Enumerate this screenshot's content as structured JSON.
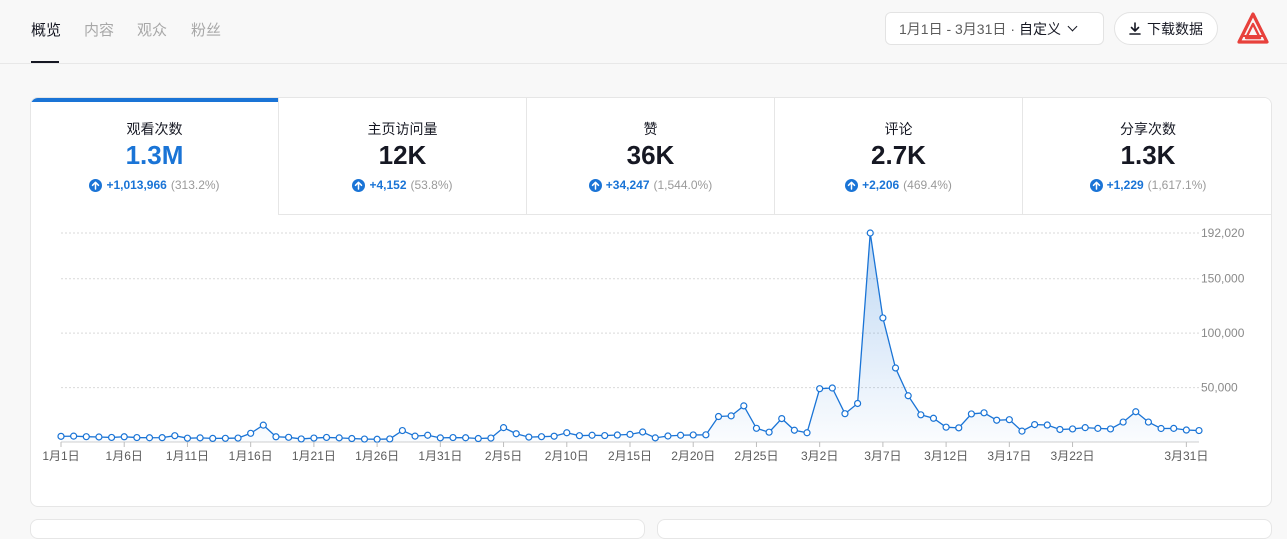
{
  "tabs": [
    {
      "label": "概览",
      "active": true
    },
    {
      "label": "内容",
      "active": false
    },
    {
      "label": "观众",
      "active": false
    },
    {
      "label": "粉丝",
      "active": false
    }
  ],
  "date_range": {
    "range": "1月1日 - 3月31日",
    "separator": "·",
    "mode": "自定义"
  },
  "download_label": "下载数据",
  "logo_icon": "brand-logo-icon",
  "colors": {
    "accent": "#1a74d6",
    "brand_red": "#e8413c"
  },
  "metrics": [
    {
      "label": "观看次数",
      "value": "1.3M",
      "delta": "+1,013,966",
      "pct": "(313.2%)",
      "active": true
    },
    {
      "label": "主页访问量",
      "value": "12K",
      "delta": "+4,152",
      "pct": "(53.8%)",
      "active": false
    },
    {
      "label": "赞",
      "value": "36K",
      "delta": "+34,247",
      "pct": "(1,544.0%)",
      "active": false
    },
    {
      "label": "评论",
      "value": "2.7K",
      "delta": "+2,206",
      "pct": "(469.4%)",
      "active": false
    },
    {
      "label": "分享次数",
      "value": "1.3K",
      "delta": "+1,229",
      "pct": "(1,617.1%)",
      "active": false
    }
  ],
  "chart_data": {
    "type": "area",
    "series_label": "观看次数",
    "ylim": [
      0,
      192020
    ],
    "yticks": [
      50000,
      100000,
      150000,
      192020
    ],
    "ytick_labels": [
      "50,000",
      "100,000",
      "150,000",
      "192,020"
    ],
    "xtick_labels": [
      "1月1日",
      "1月6日",
      "1月11日",
      "1月16日",
      "1月21日",
      "1月26日",
      "1月31日",
      "2月5日",
      "2月10日",
      "2月15日",
      "2月20日",
      "2月25日",
      "3月2日",
      "3月7日",
      "3月12日",
      "3月17日",
      "3月22日",
      "3月31日"
    ],
    "xtick_days": [
      0,
      5,
      10,
      15,
      20,
      25,
      30,
      35,
      40,
      45,
      50,
      55,
      60,
      65,
      70,
      75,
      80,
      89
    ],
    "grid": true,
    "values": [
      5200,
      5400,
      4900,
      4600,
      4200,
      4800,
      4100,
      3900,
      4000,
      5800,
      3500,
      3800,
      3300,
      3400,
      3600,
      8000,
      15500,
      4800,
      4300,
      2800,
      3600,
      4200,
      3800,
      3200,
      2700,
      2500,
      2800,
      10500,
      5400,
      6200,
      3800,
      4100,
      3900,
      3200,
      3600,
      13200,
      7600,
      4500,
      4900,
      5300,
      8500,
      5800,
      6200,
      5900,
      6400,
      7000,
      9200,
      3800,
      5500,
      6200,
      6500,
      6600,
      23400,
      24000,
      33200,
      12600,
      9000,
      21500,
      10800,
      8500,
      49000,
      49600,
      26000,
      35400,
      192020,
      114000,
      68000,
      42500,
      25000,
      21800,
      13600,
      13000,
      25800,
      26800,
      20000,
      20500,
      10000,
      16000,
      15600,
      11500,
      12000,
      13200,
      12500,
      12000,
      18300,
      27800,
      18300,
      12400,
      12500,
      11000,
      10500
    ]
  }
}
